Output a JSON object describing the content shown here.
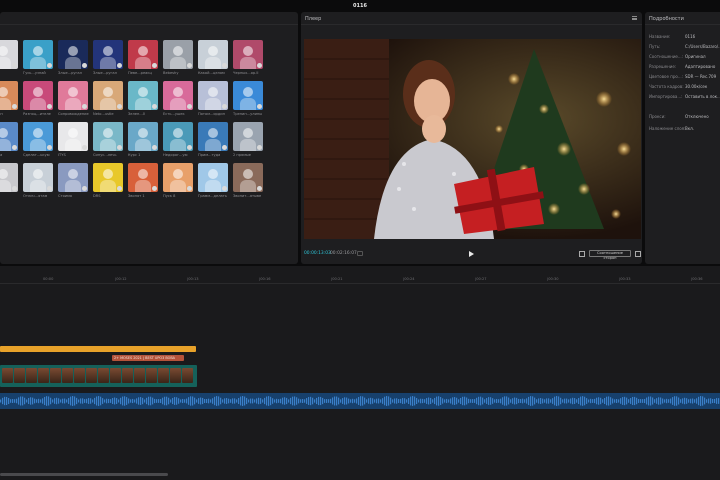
{
  "app": {
    "title": "0116"
  },
  "media": {
    "items": [
      {
        "label": "",
        "color": "#d8d8dc"
      },
      {
        "label": "Гусь...узнай",
        "color": "#3aa0c8"
      },
      {
        "label": "Злые...ругал",
        "color": "#1a2a5a"
      },
      {
        "label": "Злые...ругал",
        "color": "#23347a"
      },
      {
        "label": "Певе...реакц",
        "color": "#c03a4a"
      },
      {
        "label": "Bebeshy",
        "color": "#9aa0a8"
      },
      {
        "label": "Какой...целом",
        "color": "#c8d0d8"
      },
      {
        "label": "Черных...ор.II",
        "color": "#b04a6a"
      },
      {
        "label": "...вилон",
        "color": "#d88a5a"
      },
      {
        "label": "Разноц...ителе",
        "color": "#c84a7a"
      },
      {
        "label": "Сопровождение",
        "color": "#e07a9a"
      },
      {
        "label": "Neto...ustle",
        "color": "#d8a878"
      },
      {
        "label": "Зелен...0",
        "color": "#6ab8c8"
      },
      {
        "label": "Есть...ушек",
        "color": "#d86a9a"
      },
      {
        "label": "Потом...ордин",
        "color": "#b8c0d8"
      },
      {
        "label": "Тренин...улины",
        "color": "#3a8ad8"
      },
      {
        "label": "...зарна",
        "color": "#5a8ac8"
      },
      {
        "label": "Сделат...ькую",
        "color": "#4a9ad8"
      },
      {
        "label": "ITYS",
        "color": "#e8e8ea"
      },
      {
        "label": "Синус...лечь",
        "color": "#7ab8c8"
      },
      {
        "label": "Курс 1",
        "color": "#6aa8c8"
      },
      {
        "label": "Недорог...ую",
        "color": "#4a9ab8"
      },
      {
        "label": "Прим...туда",
        "color": "#3a7ab8"
      },
      {
        "label": "2 прямые",
        "color": "#9aa4b0"
      },
      {
        "label": "...зная",
        "color": "#c8c8cc"
      },
      {
        "label": "Отлич...ятам",
        "color": "#c8d0d8"
      },
      {
        "label": "Стоимо",
        "color": "#8a9ac0"
      },
      {
        "label": "DRS",
        "color": "#e8c82a"
      },
      {
        "label": "Звонят 1",
        "color": "#d8603a"
      },
      {
        "label": "Пуск 8",
        "color": "#e8a06a"
      },
      {
        "label": "Грамм...делать",
        "color": "#a0c8e8"
      },
      {
        "label": "Звонит...ятыве",
        "color": "#8a6a5a"
      }
    ]
  },
  "player": {
    "title": "Плеер",
    "current_time": "00:00:13:03",
    "duration": "00:02:16:07",
    "ratio_label": "Соотношение сторон"
  },
  "details": {
    "title": "Подробности",
    "rows": [
      {
        "key": "Название:",
        "value": "0116"
      },
      {
        "key": "Путь:",
        "value": "C:/Users/Bazaro/..."
      },
      {
        "key": "Соотношение...:",
        "value": "Оригинал"
      },
      {
        "key": "Разрешение:",
        "value": "Адаптировано"
      },
      {
        "key": "Цветовое про...:",
        "value": "SDR — Rec.709"
      },
      {
        "key": "Частота кадров:",
        "value": "30.00к/сек"
      },
      {
        "key": "Импортирова...:",
        "value": "Оставить в лок..."
      },
      {
        "key": "Прокси:",
        "value": "Отключено"
      },
      {
        "key": "Наложение слоя:",
        "value": "Вкл."
      }
    ]
  },
  "timeline": {
    "ticks": [
      "00:00",
      "|00:12",
      "|00:13",
      "|00:16",
      "|00:21",
      "|00:24",
      "|00:27",
      "|00:30",
      "|00:33",
      "|00:36"
    ],
    "music_label": "2+ MOSES 2021 | BEST UPO3 ВОВА"
  },
  "icons": {
    "play": "play-icon",
    "menu": "hamburger-menu-icon",
    "fit": "fit-screen-icon",
    "fullscreen": "fullscreen-icon"
  }
}
